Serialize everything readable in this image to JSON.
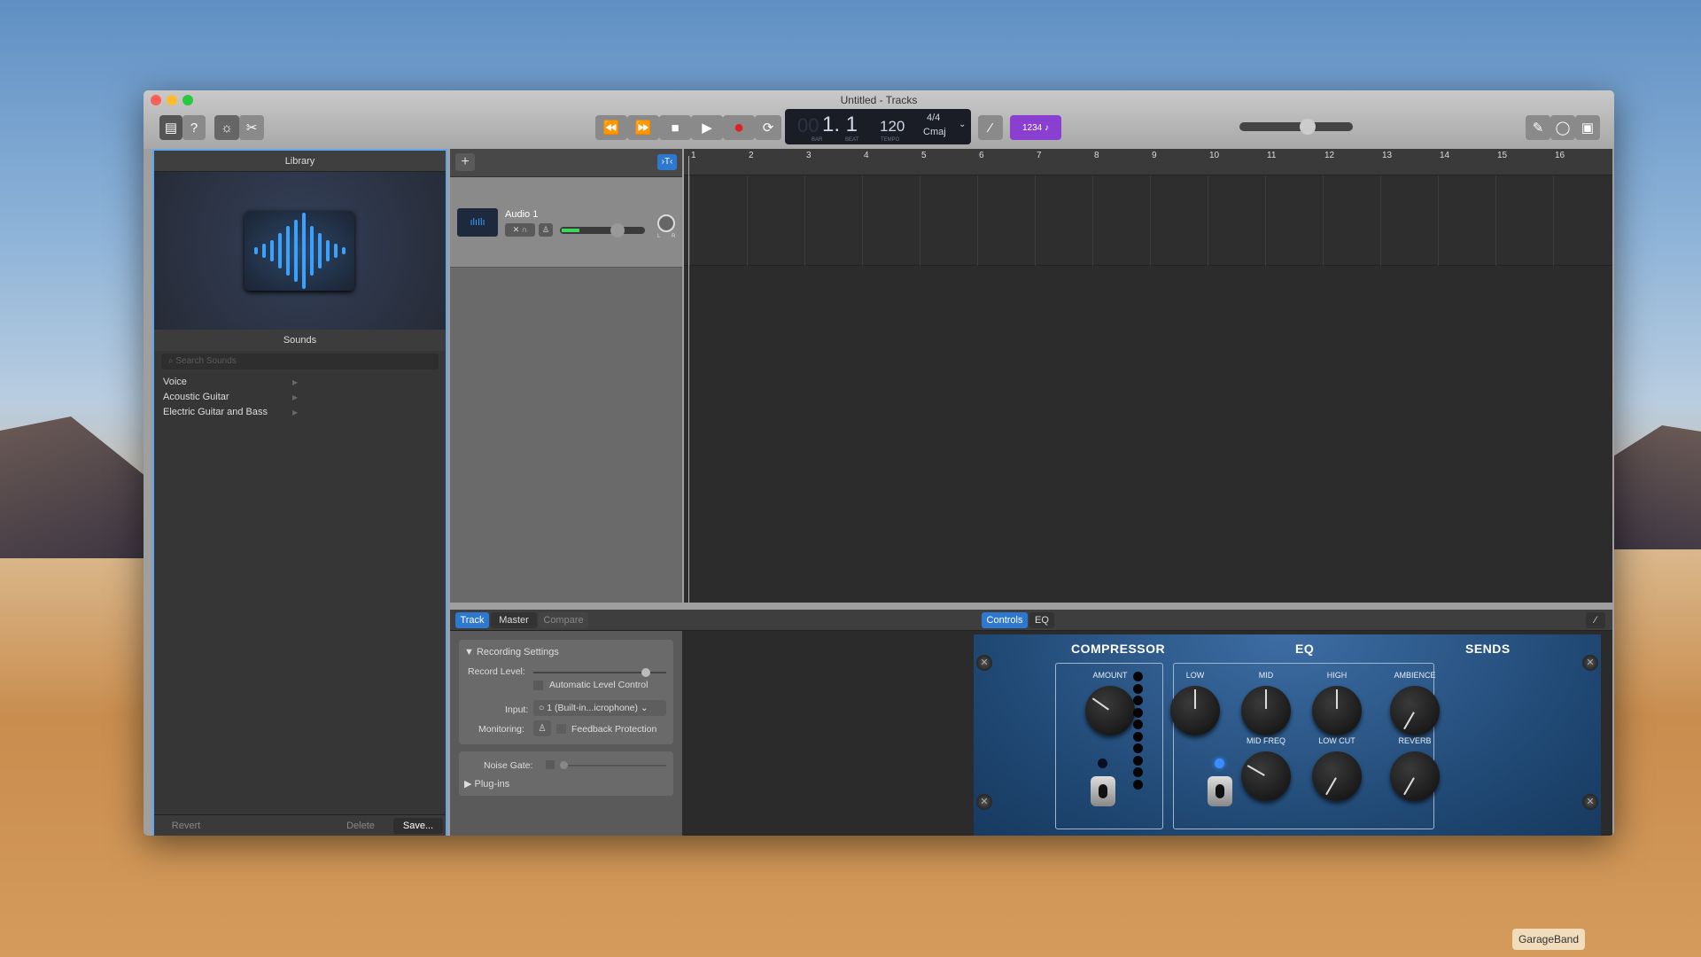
{
  "window": {
    "title": "Untitled - Tracks"
  },
  "toolbar": {
    "rewind": "⏪",
    "forward": "⏩",
    "stop": "■",
    "play": "▶",
    "record": "●",
    "cycle": "⟳",
    "lcd": {
      "bar_beat": "1. 1",
      "bar_ghost": "00",
      "bar_label": "BAR",
      "beat_label": "BEAT",
      "tempo": "120",
      "tempo_label": "TEMPO",
      "time_signature": "4/4",
      "key": "Cmaj"
    },
    "count_in": "1234",
    "master_volume": 0.62,
    "accent": "#8a3fd1"
  },
  "library": {
    "title": "Library",
    "sounds_title": "Sounds",
    "search_placeholder": "Search Sounds",
    "items": [
      {
        "label": "Voice"
      },
      {
        "label": "Acoustic Guitar"
      },
      {
        "label": "Electric Guitar and Bass"
      }
    ],
    "revert": "Revert",
    "delete": "Delete",
    "save": "Save..."
  },
  "tracks": {
    "add": "+",
    "items": [
      {
        "name": "Audio 1",
        "volume": 0.71,
        "pan_l": "L",
        "pan_r": "R"
      }
    ]
  },
  "ruler": {
    "bars": [
      "1",
      "2",
      "3",
      "4",
      "5",
      "6",
      "7",
      "8",
      "9",
      "10",
      "11",
      "12",
      "13",
      "14",
      "15",
      "16"
    ]
  },
  "smart_controls": {
    "tabs": [
      {
        "label": "Track",
        "active": true
      },
      {
        "label": "Master"
      },
      {
        "label": "Compare"
      }
    ],
    "view_tabs": [
      {
        "label": "Controls",
        "active": true
      },
      {
        "label": "EQ"
      }
    ],
    "recording_settings": {
      "title": "Recording Settings",
      "record_level_label": "Record Level:",
      "record_level": 0.87,
      "auto_level": "Automatic Level Control",
      "input_label": "Input:",
      "input_value": "1 (Built-in...icrophone)",
      "monitoring_label": "Monitoring:",
      "feedback": "Feedback Protection"
    },
    "noise_gate_label": "Noise Gate:",
    "plugins": "Plug-ins",
    "plugin": {
      "compressor": "COMPRESSOR",
      "eq": "EQ",
      "sends": "SENDS",
      "knobs": {
        "amount": "AMOUNT",
        "low": "LOW",
        "mid": "MID",
        "high": "HIGH",
        "mid_freq": "MID FREQ",
        "low_cut": "LOW CUT",
        "ambience": "AMBIENCE",
        "reverb": "REVERB"
      }
    }
  },
  "dock": {
    "tooltip": "GarageBand"
  }
}
